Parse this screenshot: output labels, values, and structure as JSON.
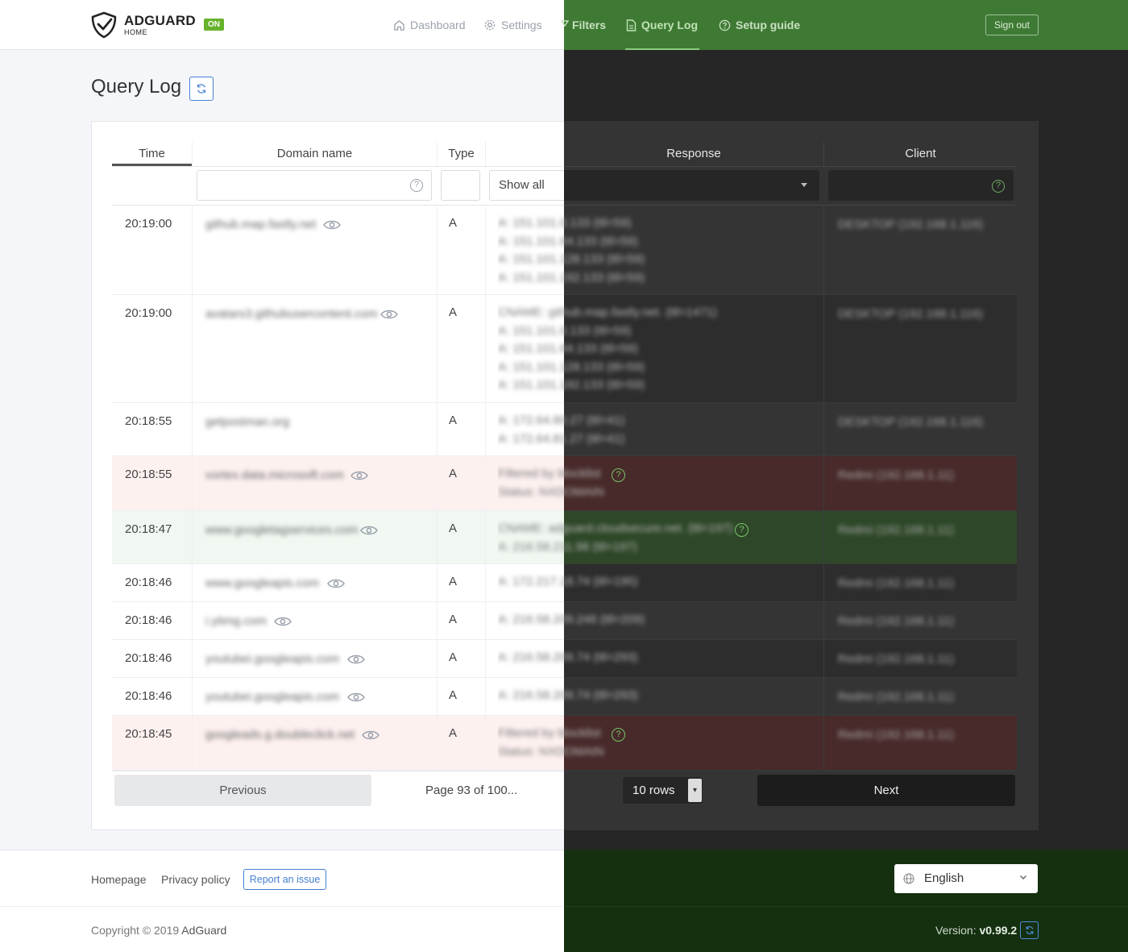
{
  "header": {
    "logo_name": "ADGUARD",
    "logo_sub": "HOME",
    "status_badge": "ON",
    "nav": {
      "dashboard": "Dashboard",
      "settings": "Settings",
      "filters": "Filters",
      "query_log": "Query Log",
      "setup_guide": "Setup guide"
    },
    "sign_out": "Sign out"
  },
  "page": {
    "title": "Query Log"
  },
  "table": {
    "columns": {
      "time": "Time",
      "domain": "Domain name",
      "type": "Type",
      "response": "Response",
      "client": "Client"
    },
    "filters": {
      "response_selected": "Show all"
    },
    "rows": [
      {
        "time": "20:19:00",
        "domain": "github.map.fastly.net",
        "type": "A",
        "status": "normal",
        "response": "A: 151.101.0.133 (ttl=59)\nA: 151.101.64.133 (ttl=59)\nA: 151.101.128.133 (ttl=59)\nA: 151.101.192.133 (ttl=59)",
        "client": "DESKTOP (192.168.1.116)"
      },
      {
        "time": "20:19:00",
        "domain": "avatars3.githubusercontent.com",
        "type": "A",
        "status": "normal",
        "response": "CNAME: github.map.fastly.net. (ttl=1471)\nA: 151.101.0.133 (ttl=59)\nA: 151.101.64.133 (ttl=59)\nA: 151.101.128.133 (ttl=59)\nA: 151.101.192.133 (ttl=59)",
        "client": "DESKTOP (192.168.1.116)"
      },
      {
        "time": "20:18:55",
        "domain": "getpostman.org",
        "type": "A",
        "status": "normal",
        "response": "A: 172.64.80.27 (ttl=41)\nA: 172.64.81.27 (ttl=41)",
        "client": "DESKTOP (192.168.1.116)"
      },
      {
        "time": "20:18:55",
        "domain": "vortex.data.microsoft.com",
        "type": "A",
        "status": "blocked",
        "response": "Filtered by blocklist\nStatus: NXDOMAIN",
        "client": "Redmi (192.168.1.11)"
      },
      {
        "time": "20:18:47",
        "domain": "www.googletagservices.com",
        "type": "A",
        "status": "allowed",
        "response": "CNAME: adguard.cloudsecure.net. (ttl=197)\nA: 216.58.211.98 (ttl=197)",
        "client": "Redmi (192.168.1.11)"
      },
      {
        "time": "20:18:46",
        "domain": "www.googleapis.com",
        "type": "A",
        "status": "normal",
        "response": "A: 172.217.18.74 (ttl=195)",
        "client": "Redmi (192.168.1.11)"
      },
      {
        "time": "20:18:46",
        "domain": "i.ytimg.com",
        "type": "A",
        "status": "normal",
        "response": "A: 216.58.209.246 (ttl=209)",
        "client": "Redmi (192.168.1.11)"
      },
      {
        "time": "20:18:46",
        "domain": "youtubei.googleapis.com",
        "type": "A",
        "status": "normal",
        "response": "A: 216.58.209.74 (ttl=293)",
        "client": "Redmi (192.168.1.11)"
      },
      {
        "time": "20:18:46",
        "domain": "youtubei.googleapis.com",
        "type": "A",
        "status": "normal",
        "response": "A: 216.58.209.74 (ttl=293)",
        "client": "Redmi (192.168.1.11)"
      },
      {
        "time": "20:18:45",
        "domain": "googleads.g.doubleclick.net",
        "type": "A",
        "status": "blocked",
        "response": "Filtered by blocklist\nStatus: NXDOMAIN",
        "client": "Redmi (192.168.1.11)"
      }
    ]
  },
  "pagination": {
    "previous": "Previous",
    "page_info": "Page 93 of 100...",
    "rows_select": "10 rows",
    "next": "Next"
  },
  "footer": {
    "homepage": "Homepage",
    "privacy": "Privacy policy",
    "report": "Report an issue",
    "copyright_prefix": "Copyright © 2019 ",
    "copyright_brand": "AdGuard",
    "language": "English",
    "version_label": "Version: ",
    "version_number": "v0.99.2"
  },
  "colors": {
    "accent_blue": "#467fcf",
    "on_badge": "#67b22b",
    "blocked_row_light": "#fdf1f0",
    "blocked_row_dark": "#482a2a",
    "allowed_row_light": "#f0f8f1",
    "allowed_row_dark": "#2e4728"
  }
}
